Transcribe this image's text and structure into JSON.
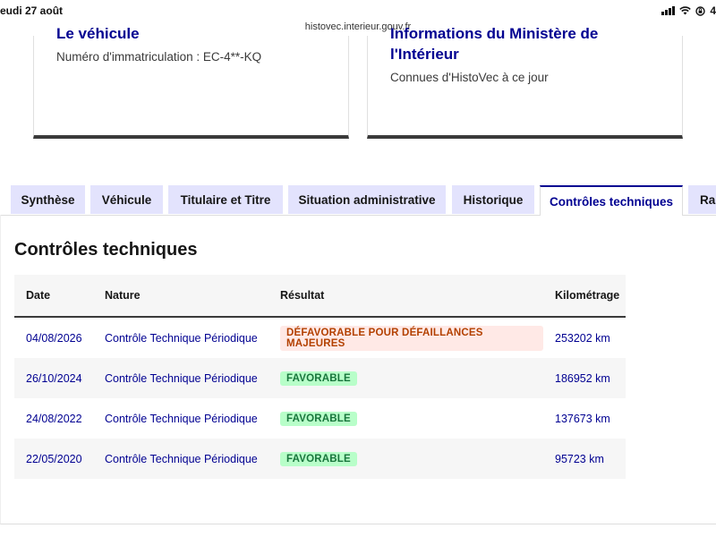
{
  "status_bar": {
    "date": "eudi 27 août",
    "url": "histovec.interieur.gouv.fr",
    "time": "4",
    "signal_icon": "cellular-signal-icon",
    "wifi_icon": "wifi-icon",
    "lock_icon": "orientation-lock-icon",
    "battery_icon": "battery-icon"
  },
  "cards": {
    "left": {
      "title": "Le véhicule",
      "text": "Numéro d'immatriculation : EC-4**-KQ"
    },
    "right": {
      "title_line1": "Informations du Ministère de",
      "title_line2": "l'Intérieur",
      "text": "Connues d'HistoVec à ce jour"
    }
  },
  "tabs": [
    {
      "label": "Synthèse"
    },
    {
      "label": "Véhicule"
    },
    {
      "label": "Titulaire et Titre"
    },
    {
      "label": "Situation administrative"
    },
    {
      "label": "Historique"
    },
    {
      "label": "Contrôles techniques"
    },
    {
      "label": "Rap"
    }
  ],
  "panel": {
    "title": "Contrôles techniques"
  },
  "table": {
    "headers": {
      "date": "Date",
      "nature": "Nature",
      "resultat": "Résultat",
      "kilometrage": "Kilométrage"
    },
    "rows": [
      {
        "date": "04/08/2026",
        "nature": "Contrôle Technique Périodique",
        "resultat": "DÉFAVORABLE POUR DÉFAILLANCES MAJEURES",
        "km": "253202 km"
      },
      {
        "date": "26/10/2024",
        "nature": "Contrôle Technique Périodique",
        "resultat": "FAVORABLE",
        "km": "186952 km"
      },
      {
        "date": "24/08/2022",
        "nature": "Contrôle Technique Périodique",
        "resultat": "FAVORABLE",
        "km": "137673 km"
      },
      {
        "date": "22/05/2020",
        "nature": "Contrôle Technique Périodique",
        "resultat": "FAVORABLE",
        "km": "95723 km"
      }
    ]
  },
  "colors": {
    "brand_blue": "#000091",
    "tab_bg": "#e3e3fd",
    "error_bg": "#ffe9e6",
    "error_fg": "#b34000",
    "success_bg": "#b8fec9",
    "success_fg": "#18753c"
  }
}
